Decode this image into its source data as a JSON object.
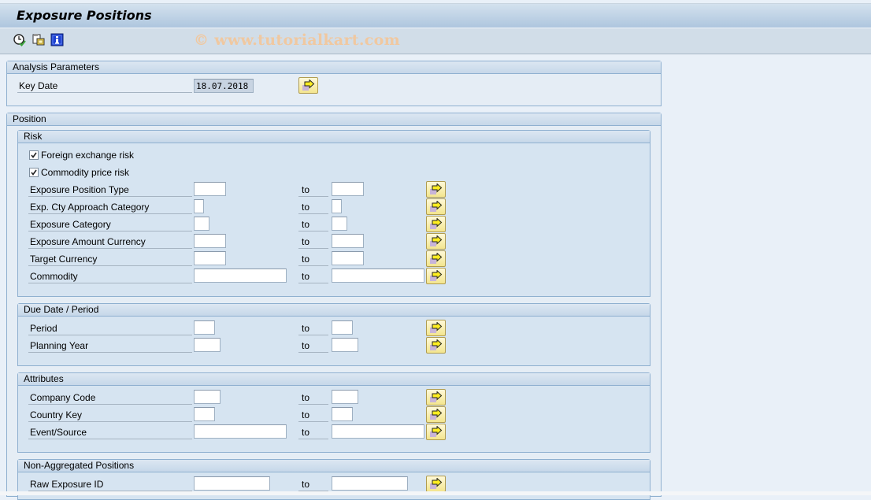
{
  "window": {
    "title": "Exposure Positions",
    "watermark": "© www.tutorialkart.com"
  },
  "toolbar": {
    "icons": [
      "execute-clock-icon",
      "get-variant-icon",
      "info-icon"
    ]
  },
  "analysis_parameters": {
    "title": "Analysis Parameters",
    "key_date_label": "Key Date",
    "key_date_value": "18.07.2018"
  },
  "position": {
    "title": "Position",
    "risk": {
      "title": "Risk",
      "checkboxes": [
        {
          "label": "Foreign exchange risk",
          "checked": true
        },
        {
          "label": "Commodity price risk",
          "checked": true
        }
      ],
      "rows": [
        {
          "label": "Exposure Position Type",
          "from": "",
          "to": ""
        },
        {
          "label": "Exp. Cty Approach Category",
          "from": "",
          "to": ""
        },
        {
          "label": "Exposure Category",
          "from": "",
          "to": ""
        },
        {
          "label": "Exposure Amount Currency",
          "from": "",
          "to": ""
        },
        {
          "label": "Target Currency",
          "from": "",
          "to": ""
        },
        {
          "label": "Commodity",
          "from": "",
          "to": ""
        }
      ]
    },
    "due_date": {
      "title": "Due Date / Period",
      "rows": [
        {
          "label": "Period",
          "from": "",
          "to": ""
        },
        {
          "label": "Planning Year",
          "from": "",
          "to": ""
        }
      ]
    },
    "attributes": {
      "title": "Attributes",
      "rows": [
        {
          "label": "Company Code",
          "from": "",
          "to": ""
        },
        {
          "label": "Country Key",
          "from": "",
          "to": ""
        },
        {
          "label": "Event/Source",
          "from": "",
          "to": ""
        }
      ]
    },
    "non_aggregated": {
      "title": "Non-Aggregated Positions",
      "rows": [
        {
          "label": "Raw Exposure ID",
          "from": "",
          "to": ""
        }
      ]
    }
  },
  "common": {
    "to_label": "to"
  }
}
